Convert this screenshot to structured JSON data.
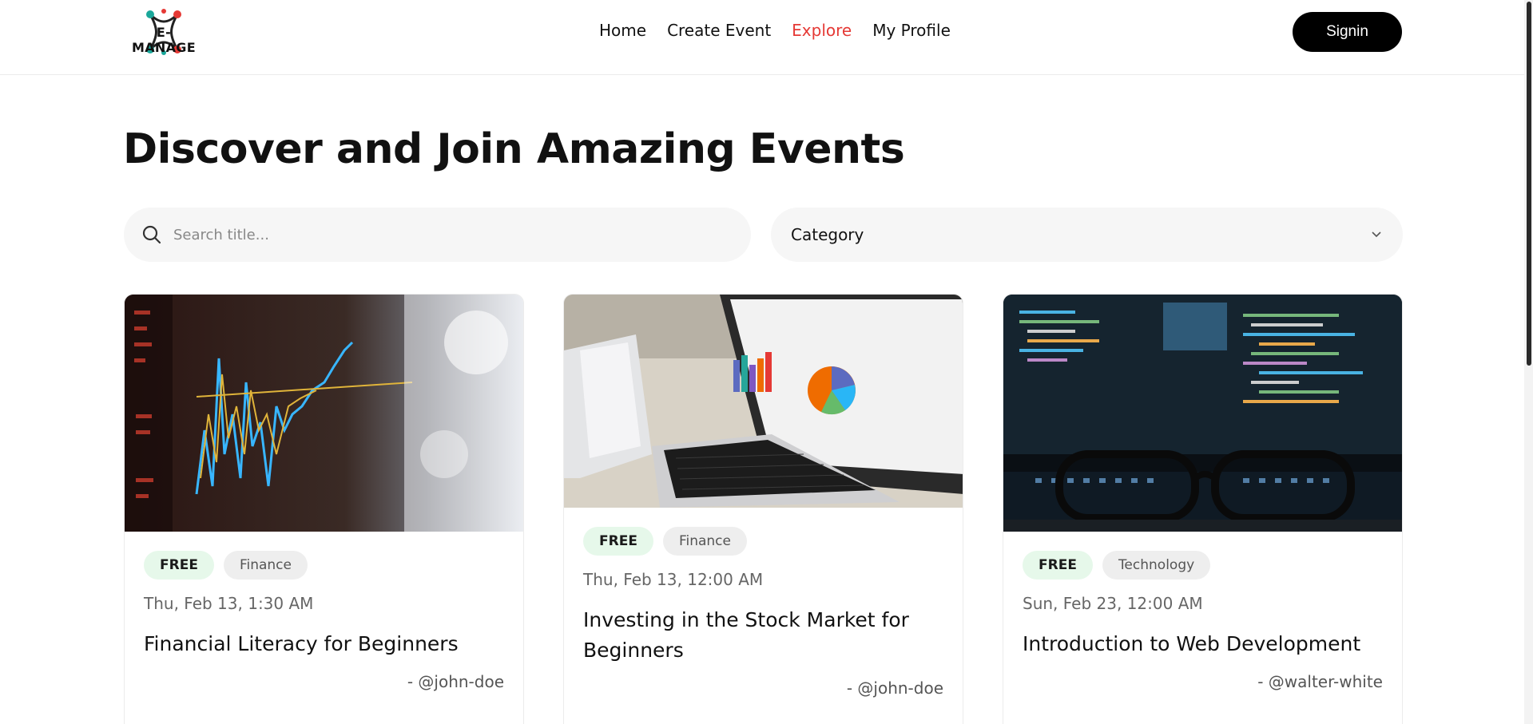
{
  "header": {
    "logo_text": "E-MANAGE",
    "nav": [
      {
        "label": "Home",
        "active": false
      },
      {
        "label": "Create Event",
        "active": false
      },
      {
        "label": "Explore",
        "active": true
      },
      {
        "label": "My Profile",
        "active": false
      }
    ],
    "signin_label": "Signin"
  },
  "main": {
    "title": "Discover and Join Amazing Events",
    "search": {
      "placeholder": "Search title...",
      "value": ""
    },
    "category": {
      "selected": "Category"
    }
  },
  "events": [
    {
      "price": "FREE",
      "category": "Finance",
      "date": "Thu, Feb 13, 1:30 AM",
      "title": "Financial Literacy for Beginners",
      "author": "- @john-doe",
      "image": "stock-chart-photo"
    },
    {
      "price": "FREE",
      "category": "Finance",
      "date": "Thu, Feb 13, 12:00 AM",
      "title": "Investing in the Stock Market for Beginners",
      "author": "- @john-doe",
      "image": "laptop-charts-photo"
    },
    {
      "price": "FREE",
      "category": "Technology",
      "date": "Sun, Feb 23, 12:00 AM",
      "title": "Introduction to Web Development",
      "author": "- @walter-white",
      "image": "code-screen-glasses-photo"
    }
  ],
  "colors": {
    "accent": "#e53935",
    "free_badge_bg": "#e6f8ea",
    "button_bg": "#000000"
  }
}
